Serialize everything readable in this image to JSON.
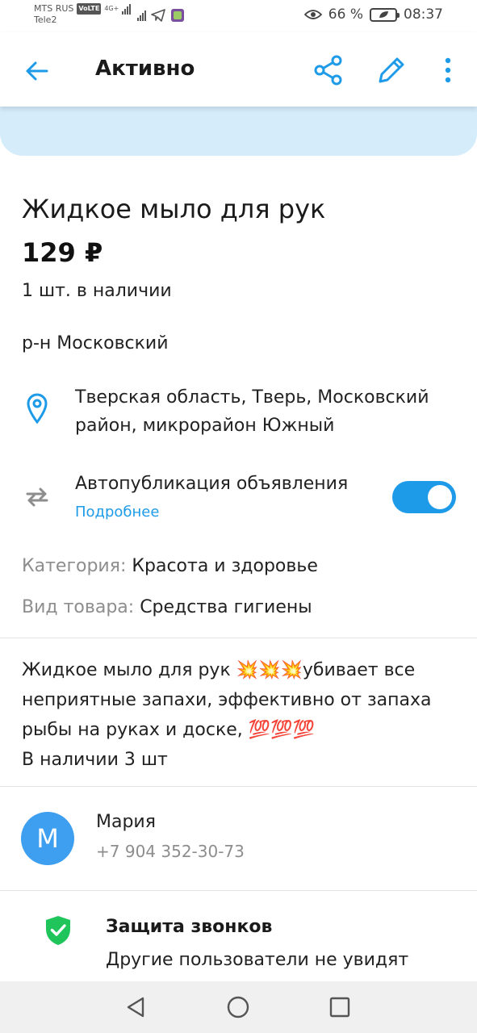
{
  "status_bar": {
    "carrier1": "MTS RUS",
    "volte": "VoLTE",
    "network": "4G+",
    "carrier2": "Tele2",
    "battery": "66 %",
    "time": "08:37"
  },
  "app_bar": {
    "title": "Активно",
    "icons": [
      "back-arrow-icon",
      "share-icon",
      "edit-pencil-icon",
      "more-vert-icon"
    ],
    "accent_color": "#1e9be8"
  },
  "listing": {
    "title": "Жидкое мыло для рук",
    "price": "129 ₽",
    "stock": "1 шт. в наличии",
    "district": "р-н Московский",
    "address_line1": "Тверская область, Тверь, Московский",
    "address_line2": "район, микрорайон Южный",
    "autopublish_label": "Автопубликация объявления",
    "autopublish_more": "Подробнее",
    "autopublish_enabled": true,
    "category_label": "Категория:",
    "category_value": "Красота и здоровье",
    "kind_label": "Вид товара:",
    "kind_value": "Средства гигиены",
    "description": "Жидкое мыло для рук 💥💥💥убивает все\nнеприятные запахи, эффективно от запаха\nрыбы на руках и доске, 💯💯💯\nВ наличии 3 шт"
  },
  "seller": {
    "initial": "М",
    "name": "Мария",
    "phone": "+7 904 352-30-73"
  },
  "call_protection": {
    "title": "Защита звонков",
    "text": "Другие пользователи не увидят"
  },
  "nav_bar": {
    "icons": [
      "nav-back-icon",
      "nav-home-icon",
      "nav-recent-icon"
    ]
  }
}
